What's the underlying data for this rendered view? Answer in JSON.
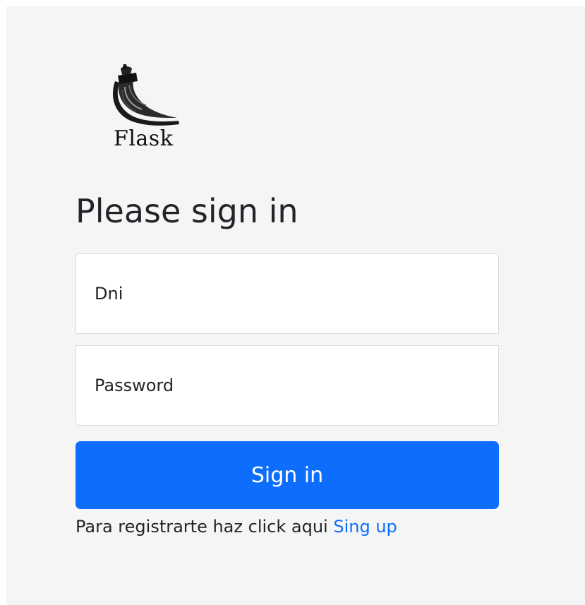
{
  "logo": {
    "icon": "flask-horn-icon",
    "text": "Flask"
  },
  "heading": "Please sign in",
  "form": {
    "dni_placeholder": "Dni",
    "password_placeholder": "Password",
    "submit_label": "Sign in"
  },
  "register": {
    "prompt": "Para registrarte haz click aqui",
    "link_label": "Sing up"
  },
  "colors": {
    "accent": "#0d6efd",
    "background": "#f5f5f5",
    "text": "#212529"
  }
}
